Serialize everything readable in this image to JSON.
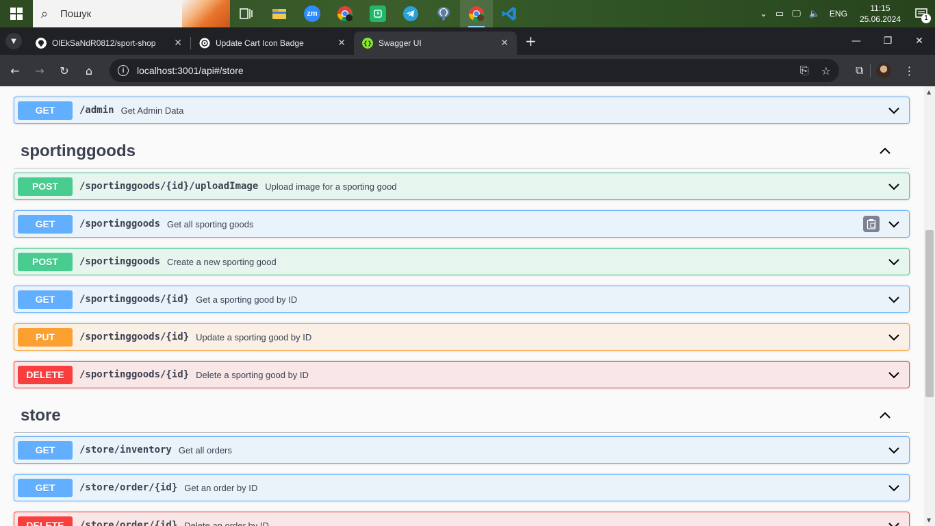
{
  "taskbar": {
    "search_placeholder": "Пошук",
    "apps": [
      {
        "name": "task-view"
      },
      {
        "name": "file-explorer",
        "color": "#f2c94c"
      },
      {
        "name": "zoom",
        "label": "zm",
        "color": "#2d8cff"
      },
      {
        "name": "chrome-profile",
        "color": "#4285f4"
      },
      {
        "name": "green-app",
        "color": "#1fb86a"
      },
      {
        "name": "telegram",
        "color": "#2aa1da"
      },
      {
        "name": "postgresql",
        "color": "#5c7fa3"
      },
      {
        "name": "chrome",
        "color": "#4285f4"
      },
      {
        "name": "vscode",
        "color": "#1f8ad2"
      }
    ],
    "language": "ENG",
    "time": "11:15",
    "date": "25.06.2024",
    "notification_count": "1"
  },
  "browser": {
    "tabs": [
      {
        "title": "OlEkSaNdR0812/sport-shop",
        "favicon": "github",
        "color": "#ffffff"
      },
      {
        "title": "Update Cart Icon Badge",
        "favicon": "openai",
        "color": "#ffffff"
      },
      {
        "title": "Swagger UI",
        "favicon": "swagger",
        "color": "#85ea2d",
        "active": true
      }
    ],
    "url": "localhost:3001/api#/store"
  },
  "swagger": {
    "admin_op": {
      "method": "GET",
      "path": "/admin",
      "summary": "Get Admin Data"
    },
    "sections": [
      {
        "name": "sportinggoods",
        "operations": [
          {
            "method": "POST",
            "path": "/sportinggoods/{id}/uploadImage",
            "summary": "Upload image for a sporting good"
          },
          {
            "method": "GET",
            "path": "/sportinggoods",
            "summary": "Get all sporting goods"
          },
          {
            "method": "POST",
            "path": "/sportinggoods",
            "summary": "Create a new sporting good"
          },
          {
            "method": "GET",
            "path": "/sportinggoods/{id}",
            "summary": "Get a sporting good by ID"
          },
          {
            "method": "PUT",
            "path": "/sportinggoods/{id}",
            "summary": "Update a sporting good by ID"
          },
          {
            "method": "DELETE",
            "path": "/sportinggoods/{id}",
            "summary": "Delete a sporting good by ID"
          }
        ]
      },
      {
        "name": "store",
        "operations": [
          {
            "method": "GET",
            "path": "/store/inventory",
            "summary": "Get all orders"
          },
          {
            "method": "GET",
            "path": "/store/order/{id}",
            "summary": "Get an order by ID"
          },
          {
            "method": "DELETE",
            "path": "/store/order/{id}",
            "summary": "Delete an order by ID"
          }
        ]
      }
    ]
  }
}
